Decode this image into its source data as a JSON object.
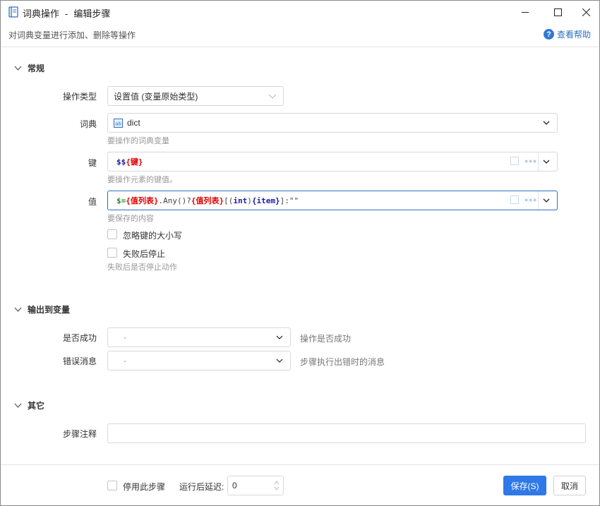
{
  "window": {
    "title": "词典操作",
    "title_separator": "-",
    "title_sub": "编辑步骤",
    "subtitle": "对词典变量进行添加、删除等操作",
    "help_label": "查看帮助"
  },
  "sections": {
    "general": "常规",
    "output": "输出到变量",
    "other": "其它"
  },
  "fields": {
    "op_type": {
      "label": "操作类型",
      "value": "设置值 (变量原始类型)"
    },
    "dict": {
      "label": "词典",
      "value": "dict",
      "hint": "要操作的词典变量"
    },
    "key": {
      "label": "键",
      "hint": "要操作元素的键值。",
      "code": {
        "prefix": "$$",
        "open": "{",
        "name": "键",
        "close": "}"
      }
    },
    "value": {
      "label": "值",
      "hint": "要保存的内容",
      "code": {
        "p1": "$=",
        "p2": "{值列表}",
        "p3": ".Any()?",
        "p4": "{值列表}",
        "p5": "[(",
        "p6": "int",
        "p7": ")",
        "p8": "{item}",
        "p9": "]:\"\""
      }
    },
    "ignore_case": {
      "label": "忽略键的大小写"
    },
    "stop_on_fail": {
      "label": "失败后停止",
      "hint": "失败后是否停止动作"
    },
    "success": {
      "label": "是否成功",
      "value": "-",
      "hint": "操作是否成功"
    },
    "error_msg": {
      "label": "错误消息",
      "value": "-",
      "hint": "步骤执行出错时的消息"
    },
    "comment": {
      "label": "步骤注释",
      "value": ""
    }
  },
  "footer": {
    "disable_label": "停用此步骤",
    "delay_label": "运行后延迟:",
    "delay_value": "0",
    "save_label": "保存(S)",
    "cancel_label": "取消"
  },
  "colors": {
    "accent": "#2f78e8",
    "code_red": "#e00000",
    "code_blue": "#1a1aa6"
  }
}
